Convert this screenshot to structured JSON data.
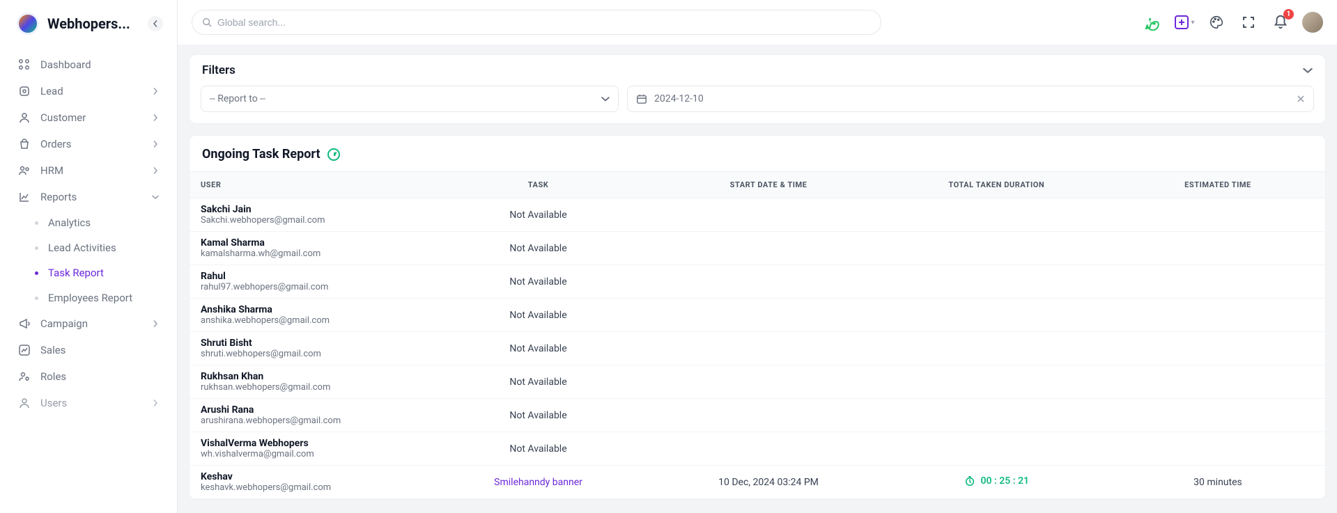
{
  "brand": {
    "name": "Webhopers..."
  },
  "sidebar": {
    "items": [
      {
        "label": "Dashboard"
      },
      {
        "label": "Lead"
      },
      {
        "label": "Customer"
      },
      {
        "label": "Orders"
      },
      {
        "label": "HRM"
      },
      {
        "label": "Reports"
      },
      {
        "label": "Campaign"
      },
      {
        "label": "Sales"
      },
      {
        "label": "Roles"
      },
      {
        "label": "Users"
      }
    ],
    "reports_sub": [
      {
        "label": "Analytics"
      },
      {
        "label": "Lead Activities"
      },
      {
        "label": "Task Report"
      },
      {
        "label": "Employees Report"
      }
    ]
  },
  "search": {
    "placeholder": "Global search..."
  },
  "notifications": {
    "count": "1"
  },
  "filters": {
    "title": "Filters",
    "report_to_placeholder": "-- Report to --",
    "date_value": "2024-12-10"
  },
  "report": {
    "title": "Ongoing Task Report",
    "columns": {
      "user": "USER",
      "task": "TASK",
      "start": "START DATE & TIME",
      "duration": "TOTAL TAKEN DURATION",
      "estimated": "ESTIMATED TIME"
    },
    "rows": [
      {
        "name": "Sakchi Jain",
        "email": "Sakchi.webhopers@gmail.com",
        "task": "Not Available",
        "start": "",
        "duration": "",
        "estimated": ""
      },
      {
        "name": "Kamal Sharma",
        "email": "kamalsharma.wh@gmail.com",
        "task": "Not Available",
        "start": "",
        "duration": "",
        "estimated": ""
      },
      {
        "name": "Rahul",
        "email": "rahul97.webhopers@gmail.com",
        "task": "Not Available",
        "start": "",
        "duration": "",
        "estimated": ""
      },
      {
        "name": "Anshika Sharma",
        "email": "anshika.webhopers@gmail.com",
        "task": "Not Available",
        "start": "",
        "duration": "",
        "estimated": ""
      },
      {
        "name": "Shruti Bisht",
        "email": "shruti.webhopers@gmail.com",
        "task": "Not Available",
        "start": "",
        "duration": "",
        "estimated": ""
      },
      {
        "name": "Rukhsan Khan",
        "email": "rukhsan.webhopers@gmail.com",
        "task": "Not Available",
        "start": "",
        "duration": "",
        "estimated": ""
      },
      {
        "name": "Arushi Rana",
        "email": "arushirana.webhopers@gmail.com",
        "task": "Not Available",
        "start": "",
        "duration": "",
        "estimated": ""
      },
      {
        "name": "VishalVerma Webhopers",
        "email": "wh.vishalverma@gmail.com",
        "task": "Not Available",
        "start": "",
        "duration": "",
        "estimated": ""
      },
      {
        "name": "Keshav",
        "email": "keshavk.webhopers@gmail.com",
        "task": "Smilehanndy banner",
        "task_link": true,
        "start": "10 Dec, 2024 03:24 PM",
        "duration": "00 : 25 : 21",
        "duration_timer": true,
        "estimated": "30 minutes"
      }
    ]
  }
}
